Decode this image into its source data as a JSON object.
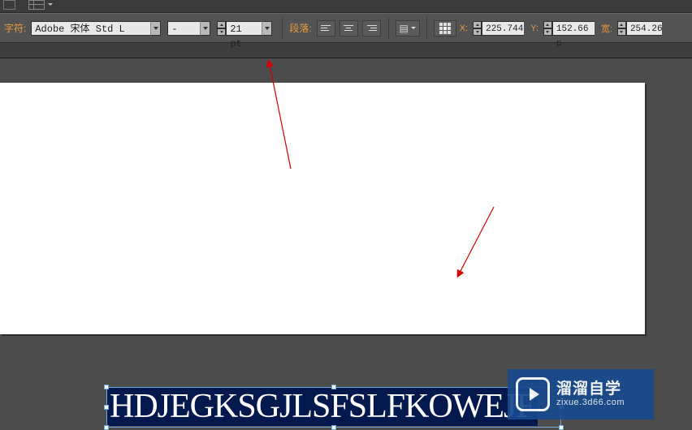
{
  "labels": {
    "character_label": "字符:",
    "paragraph_label": "段落:",
    "x_label": "X:",
    "y_label": "Y:",
    "w_label": "宽:"
  },
  "font": {
    "family": "Adobe 宋体 Std L",
    "style": "-",
    "size": "21 pt"
  },
  "coords": {
    "x": "225.744",
    "y": "152.66 p",
    "w": "254.26"
  },
  "canvas": {
    "text": "HDJEGKSGJLSFSLFKOWEJF"
  },
  "watermark": {
    "title": "溜溜自学",
    "url": "zixue.3d66.com"
  }
}
